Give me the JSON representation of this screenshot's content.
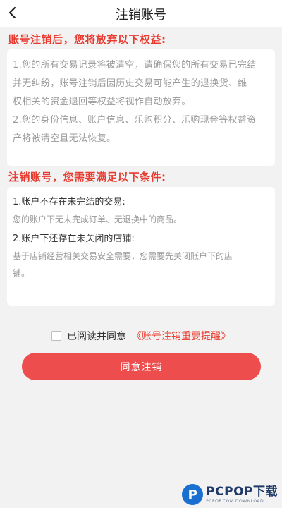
{
  "header": {
    "title": "注销账号",
    "back_icon": "chevron-left-icon"
  },
  "section1": {
    "heading": "账号注销后，您将放弃以下权益:",
    "paragraph1_line1": "1.您的所有交易记录将被清空，请确保您的所有交易已完结",
    "paragraph1_line2": "并无纠纷，账号注销后因历史交易可能产生的退换货、维",
    "paragraph1_line3": "权相关的资金退回等权益将视作自动放弃。",
    "paragraph2_line1": "2.您的身份信息、账户信息、乐购积分、乐购现金等权益资",
    "paragraph2_line2": "产将被清空且无法恢复。"
  },
  "section2": {
    "heading": "注销账号，您需要满足以下条件:",
    "conditions": [
      {
        "title": "1.账户不存在未完结的交易:",
        "body_line1": "您的账户下无未完成订单、无退换中的商品。",
        "body_line2": ""
      },
      {
        "title": "2.账户下还存在未关闭的店铺:",
        "body_line1": "基于店铺经营相关交易安全需要，您需要先关闭账户下的店",
        "body_line2": "铺。"
      }
    ]
  },
  "agreement": {
    "prefix": "已阅读并同意",
    "link": "《账号注销重要提醒》",
    "checked": false
  },
  "confirm_button": {
    "label": "同意注销"
  },
  "watermark": {
    "logo_letter": "P",
    "brand": "PCPOP下载",
    "sub": "PCPOP.COM DOWNLOAD"
  },
  "colors": {
    "accent": "#e83a2f",
    "button": "#ee4d4d",
    "background": "#f2f2f2"
  }
}
